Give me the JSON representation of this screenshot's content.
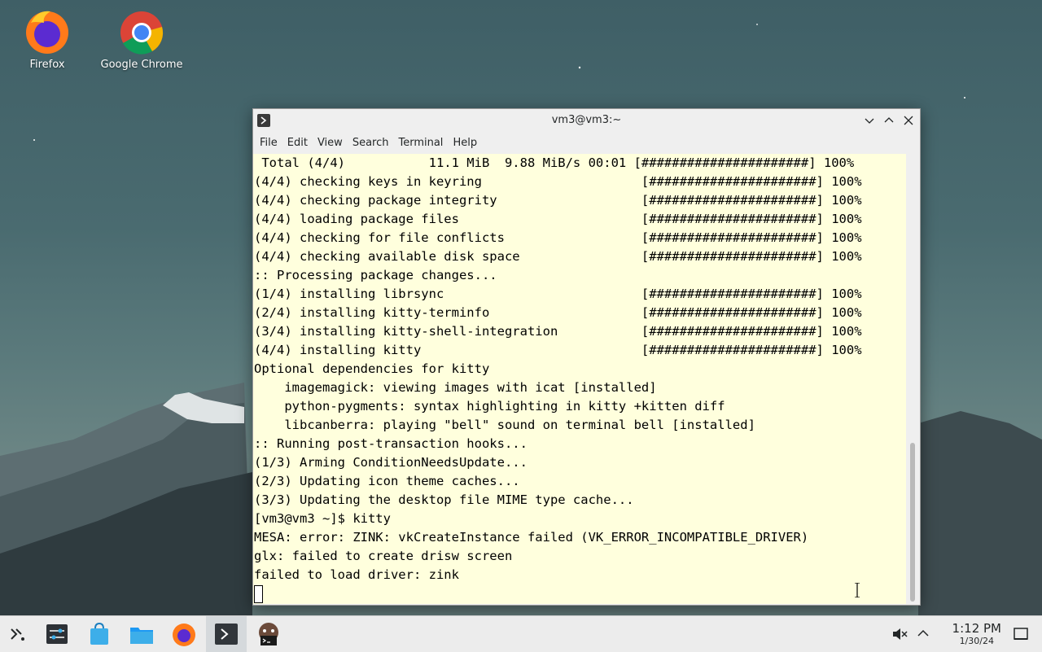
{
  "desktop": {
    "icons": [
      {
        "label": "Firefox"
      },
      {
        "label": "Google Chrome"
      }
    ]
  },
  "window": {
    "title": "vm3@vm3:~",
    "menu": [
      "File",
      "Edit",
      "View",
      "Search",
      "Terminal",
      "Help"
    ],
    "lines": [
      " Total (4/4)           11.1 MiB  9.88 MiB/s 00:01 [######################] 100%",
      "(4/4) checking keys in keyring                     [######################] 100%",
      "(4/4) checking package integrity                   [######################] 100%",
      "(4/4) loading package files                        [######################] 100%",
      "(4/4) checking for file conflicts                  [######################] 100%",
      "(4/4) checking available disk space                [######################] 100%",
      ":: Processing package changes...",
      "(1/4) installing librsync                          [######################] 100%",
      "(2/4) installing kitty-terminfo                    [######################] 100%",
      "(3/4) installing kitty-shell-integration           [######################] 100%",
      "(4/4) installing kitty                             [######################] 100%",
      "Optional dependencies for kitty",
      "    imagemagick: viewing images with icat [installed]",
      "    python-pygments: syntax highlighting in kitty +kitten diff",
      "    libcanberra: playing \"bell\" sound on terminal bell [installed]",
      ":: Running post-transaction hooks...",
      "(1/3) Arming ConditionNeedsUpdate...",
      "(2/3) Updating icon theme caches...",
      "(3/3) Updating the desktop file MIME type cache...",
      "[vm3@vm3 ~]$ kitty",
      "MESA: error: ZINK: vkCreateInstance failed (VK_ERROR_INCOMPATIBLE_DRIVER)",
      "glx: failed to create drisw screen",
      "failed to load driver: zink"
    ]
  },
  "taskbar": {
    "time": "1:12 PM",
    "date": "1/30/24",
    "icons": [
      "application-launcher-icon",
      "settings-icon",
      "discover-store-icon",
      "file-manager-icon",
      "firefox-icon",
      "konsole-icon",
      "xterm-icon"
    ]
  },
  "colors": {
    "terminal_bg": "#ffffdd",
    "chrome_bg": "#efefef",
    "taskbar_bg": "#ececec"
  }
}
